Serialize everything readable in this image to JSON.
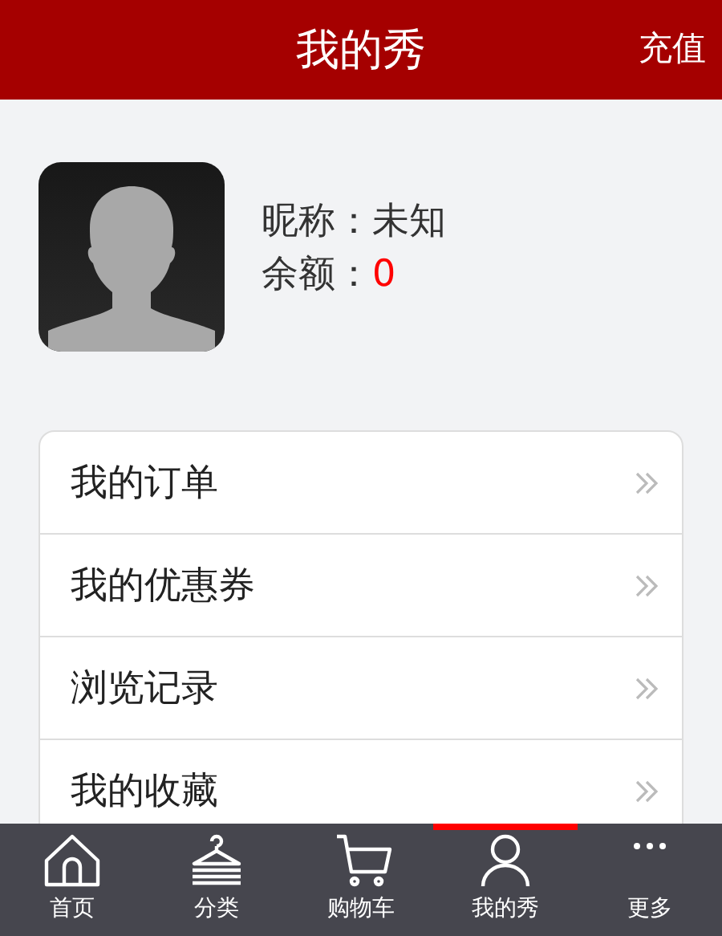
{
  "header": {
    "title": "我的秀",
    "action": "充值"
  },
  "profile": {
    "nickname_label": "昵称：",
    "nickname": "未知",
    "balance_label": "余额：",
    "balance": "0"
  },
  "menu": [
    {
      "label": "我的订单"
    },
    {
      "label": "我的优惠券"
    },
    {
      "label": "浏览记录"
    },
    {
      "label": "我的收藏"
    }
  ],
  "tabbar": [
    {
      "label": "首页",
      "kind": "home",
      "selected": false
    },
    {
      "label": "分类",
      "kind": "category",
      "selected": false
    },
    {
      "label": "购物车",
      "kind": "cart",
      "selected": false
    },
    {
      "label": "我的秀",
      "kind": "user",
      "selected": true
    },
    {
      "label": "更多",
      "kind": "more",
      "selected": false
    }
  ]
}
